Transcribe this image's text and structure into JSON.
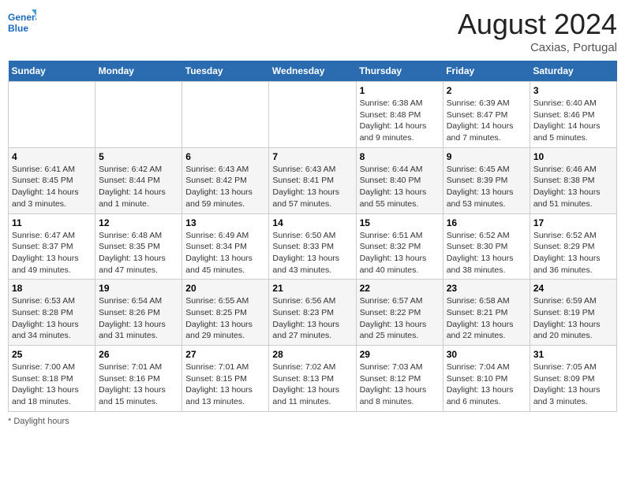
{
  "header": {
    "logo_line1": "General",
    "logo_line2": "Blue",
    "month_year": "August 2024",
    "location": "Caxias, Portugal"
  },
  "days_of_week": [
    "Sunday",
    "Monday",
    "Tuesday",
    "Wednesday",
    "Thursday",
    "Friday",
    "Saturday"
  ],
  "weeks": [
    [
      {
        "day": "",
        "info": ""
      },
      {
        "day": "",
        "info": ""
      },
      {
        "day": "",
        "info": ""
      },
      {
        "day": "",
        "info": ""
      },
      {
        "day": "1",
        "info": "Sunrise: 6:38 AM\nSunset: 8:48 PM\nDaylight: 14 hours\nand 9 minutes."
      },
      {
        "day": "2",
        "info": "Sunrise: 6:39 AM\nSunset: 8:47 PM\nDaylight: 14 hours\nand 7 minutes."
      },
      {
        "day": "3",
        "info": "Sunrise: 6:40 AM\nSunset: 8:46 PM\nDaylight: 14 hours\nand 5 minutes."
      }
    ],
    [
      {
        "day": "4",
        "info": "Sunrise: 6:41 AM\nSunset: 8:45 PM\nDaylight: 14 hours\nand 3 minutes."
      },
      {
        "day": "5",
        "info": "Sunrise: 6:42 AM\nSunset: 8:44 PM\nDaylight: 14 hours\nand 1 minute."
      },
      {
        "day": "6",
        "info": "Sunrise: 6:43 AM\nSunset: 8:42 PM\nDaylight: 13 hours\nand 59 minutes."
      },
      {
        "day": "7",
        "info": "Sunrise: 6:43 AM\nSunset: 8:41 PM\nDaylight: 13 hours\nand 57 minutes."
      },
      {
        "day": "8",
        "info": "Sunrise: 6:44 AM\nSunset: 8:40 PM\nDaylight: 13 hours\nand 55 minutes."
      },
      {
        "day": "9",
        "info": "Sunrise: 6:45 AM\nSunset: 8:39 PM\nDaylight: 13 hours\nand 53 minutes."
      },
      {
        "day": "10",
        "info": "Sunrise: 6:46 AM\nSunset: 8:38 PM\nDaylight: 13 hours\nand 51 minutes."
      }
    ],
    [
      {
        "day": "11",
        "info": "Sunrise: 6:47 AM\nSunset: 8:37 PM\nDaylight: 13 hours\nand 49 minutes."
      },
      {
        "day": "12",
        "info": "Sunrise: 6:48 AM\nSunset: 8:35 PM\nDaylight: 13 hours\nand 47 minutes."
      },
      {
        "day": "13",
        "info": "Sunrise: 6:49 AM\nSunset: 8:34 PM\nDaylight: 13 hours\nand 45 minutes."
      },
      {
        "day": "14",
        "info": "Sunrise: 6:50 AM\nSunset: 8:33 PM\nDaylight: 13 hours\nand 43 minutes."
      },
      {
        "day": "15",
        "info": "Sunrise: 6:51 AM\nSunset: 8:32 PM\nDaylight: 13 hours\nand 40 minutes."
      },
      {
        "day": "16",
        "info": "Sunrise: 6:52 AM\nSunset: 8:30 PM\nDaylight: 13 hours\nand 38 minutes."
      },
      {
        "day": "17",
        "info": "Sunrise: 6:52 AM\nSunset: 8:29 PM\nDaylight: 13 hours\nand 36 minutes."
      }
    ],
    [
      {
        "day": "18",
        "info": "Sunrise: 6:53 AM\nSunset: 8:28 PM\nDaylight: 13 hours\nand 34 minutes."
      },
      {
        "day": "19",
        "info": "Sunrise: 6:54 AM\nSunset: 8:26 PM\nDaylight: 13 hours\nand 31 minutes."
      },
      {
        "day": "20",
        "info": "Sunrise: 6:55 AM\nSunset: 8:25 PM\nDaylight: 13 hours\nand 29 minutes."
      },
      {
        "day": "21",
        "info": "Sunrise: 6:56 AM\nSunset: 8:23 PM\nDaylight: 13 hours\nand 27 minutes."
      },
      {
        "day": "22",
        "info": "Sunrise: 6:57 AM\nSunset: 8:22 PM\nDaylight: 13 hours\nand 25 minutes."
      },
      {
        "day": "23",
        "info": "Sunrise: 6:58 AM\nSunset: 8:21 PM\nDaylight: 13 hours\nand 22 minutes."
      },
      {
        "day": "24",
        "info": "Sunrise: 6:59 AM\nSunset: 8:19 PM\nDaylight: 13 hours\nand 20 minutes."
      }
    ],
    [
      {
        "day": "25",
        "info": "Sunrise: 7:00 AM\nSunset: 8:18 PM\nDaylight: 13 hours\nand 18 minutes."
      },
      {
        "day": "26",
        "info": "Sunrise: 7:01 AM\nSunset: 8:16 PM\nDaylight: 13 hours\nand 15 minutes."
      },
      {
        "day": "27",
        "info": "Sunrise: 7:01 AM\nSunset: 8:15 PM\nDaylight: 13 hours\nand 13 minutes."
      },
      {
        "day": "28",
        "info": "Sunrise: 7:02 AM\nSunset: 8:13 PM\nDaylight: 13 hours\nand 11 minutes."
      },
      {
        "day": "29",
        "info": "Sunrise: 7:03 AM\nSunset: 8:12 PM\nDaylight: 13 hours\nand 8 minutes."
      },
      {
        "day": "30",
        "info": "Sunrise: 7:04 AM\nSunset: 8:10 PM\nDaylight: 13 hours\nand 6 minutes."
      },
      {
        "day": "31",
        "info": "Sunrise: 7:05 AM\nSunset: 8:09 PM\nDaylight: 13 hours\nand 3 minutes."
      }
    ]
  ],
  "footer": "Daylight hours"
}
